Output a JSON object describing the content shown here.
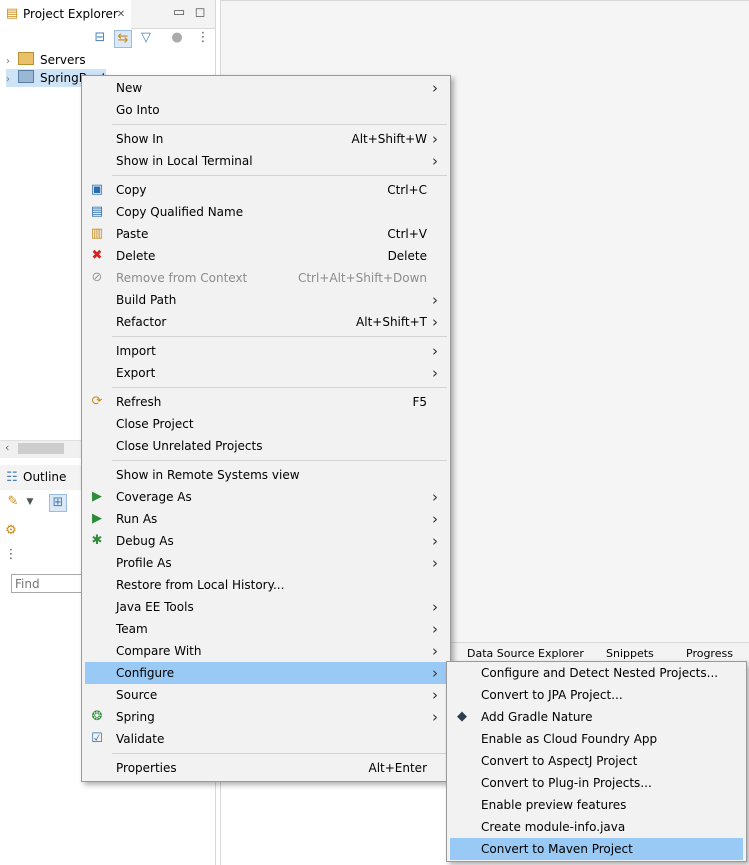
{
  "project_explorer": {
    "tab_title": "Project Explorer",
    "close_glyph": "✕",
    "minimize_glyph": "▭",
    "maximize_glyph": "◻",
    "tree": [
      {
        "label": "Servers",
        "icon": "folder-icon"
      },
      {
        "label": "SpringBoot",
        "icon": "project-icon"
      }
    ]
  },
  "outline": {
    "tab_title": "Outline",
    "find_placeholder": "Find"
  },
  "bottom_tabs": [
    "Data Source Explorer",
    "Snippets",
    "Progress"
  ],
  "context_menu": {
    "items": [
      {
        "label": "New",
        "shortcut": "",
        "submenu": true,
        "icon": ""
      },
      {
        "label": "Go Into",
        "shortcut": "",
        "submenu": false,
        "icon": ""
      },
      {
        "separator": true
      },
      {
        "label": "Show In",
        "shortcut": "Alt+Shift+W",
        "submenu": true,
        "icon": ""
      },
      {
        "label": "Show in Local Terminal",
        "shortcut": "",
        "submenu": true,
        "icon": ""
      },
      {
        "separator": true
      },
      {
        "label": "Copy",
        "shortcut": "Ctrl+C",
        "submenu": false,
        "icon": "copy-icon"
      },
      {
        "label": "Copy Qualified Name",
        "shortcut": "",
        "submenu": false,
        "icon": "copy-qualified-icon"
      },
      {
        "label": "Paste",
        "shortcut": "Ctrl+V",
        "submenu": false,
        "icon": "paste-icon"
      },
      {
        "label": "Delete",
        "shortcut": "Delete",
        "submenu": false,
        "icon": "delete-icon"
      },
      {
        "label": "Remove from Context",
        "shortcut": "Ctrl+Alt+Shift+Down",
        "submenu": false,
        "icon": "remove-context-icon",
        "disabled": true
      },
      {
        "label": "Build Path",
        "shortcut": "",
        "submenu": true,
        "icon": ""
      },
      {
        "label": "Refactor",
        "shortcut": "Alt+Shift+T",
        "submenu": true,
        "icon": ""
      },
      {
        "separator": true
      },
      {
        "label": "Import",
        "shortcut": "",
        "submenu": true,
        "icon": ""
      },
      {
        "label": "Export",
        "shortcut": "",
        "submenu": true,
        "icon": ""
      },
      {
        "separator": true
      },
      {
        "label": "Refresh",
        "shortcut": "F5",
        "submenu": false,
        "icon": "refresh-icon"
      },
      {
        "label": "Close Project",
        "shortcut": "",
        "submenu": false,
        "icon": ""
      },
      {
        "label": "Close Unrelated Projects",
        "shortcut": "",
        "submenu": false,
        "icon": ""
      },
      {
        "separator": true
      },
      {
        "label": "Show in Remote Systems view",
        "shortcut": "",
        "submenu": false,
        "icon": ""
      },
      {
        "label": "Coverage As",
        "shortcut": "",
        "submenu": true,
        "icon": "coverage-icon"
      },
      {
        "label": "Run As",
        "shortcut": "",
        "submenu": true,
        "icon": "run-icon"
      },
      {
        "label": "Debug As",
        "shortcut": "",
        "submenu": true,
        "icon": "debug-icon"
      },
      {
        "label": "Profile As",
        "shortcut": "",
        "submenu": true,
        "icon": ""
      },
      {
        "label": "Restore from Local History...",
        "shortcut": "",
        "submenu": false,
        "icon": ""
      },
      {
        "label": "Java EE Tools",
        "shortcut": "",
        "submenu": true,
        "icon": ""
      },
      {
        "label": "Team",
        "shortcut": "",
        "submenu": true,
        "icon": ""
      },
      {
        "label": "Compare With",
        "shortcut": "",
        "submenu": true,
        "icon": ""
      },
      {
        "label": "Configure",
        "shortcut": "",
        "submenu": true,
        "icon": "",
        "highlighted": true
      },
      {
        "label": "Source",
        "shortcut": "",
        "submenu": true,
        "icon": ""
      },
      {
        "label": "Spring",
        "shortcut": "",
        "submenu": true,
        "icon": "spring-icon"
      },
      {
        "label": "Validate",
        "shortcut": "",
        "submenu": false,
        "icon": "validate-icon"
      },
      {
        "separator": true
      },
      {
        "label": "Properties",
        "shortcut": "Alt+Enter",
        "submenu": false,
        "icon": ""
      }
    ]
  },
  "configure_submenu": {
    "items": [
      {
        "label": "Configure and Detect Nested Projects...",
        "icon": ""
      },
      {
        "label": "Convert to JPA Project...",
        "icon": ""
      },
      {
        "label": "Add Gradle Nature",
        "icon": "gradle-icon"
      },
      {
        "label": "Enable as Cloud Foundry App",
        "icon": ""
      },
      {
        "label": "Convert to AspectJ Project",
        "icon": ""
      },
      {
        "label": "Convert to Plug-in Projects...",
        "icon": ""
      },
      {
        "label": "Enable preview features",
        "icon": ""
      },
      {
        "label": "Create module-info.java",
        "icon": ""
      },
      {
        "label": "Convert to Maven Project",
        "icon": "",
        "highlighted": true
      }
    ]
  }
}
